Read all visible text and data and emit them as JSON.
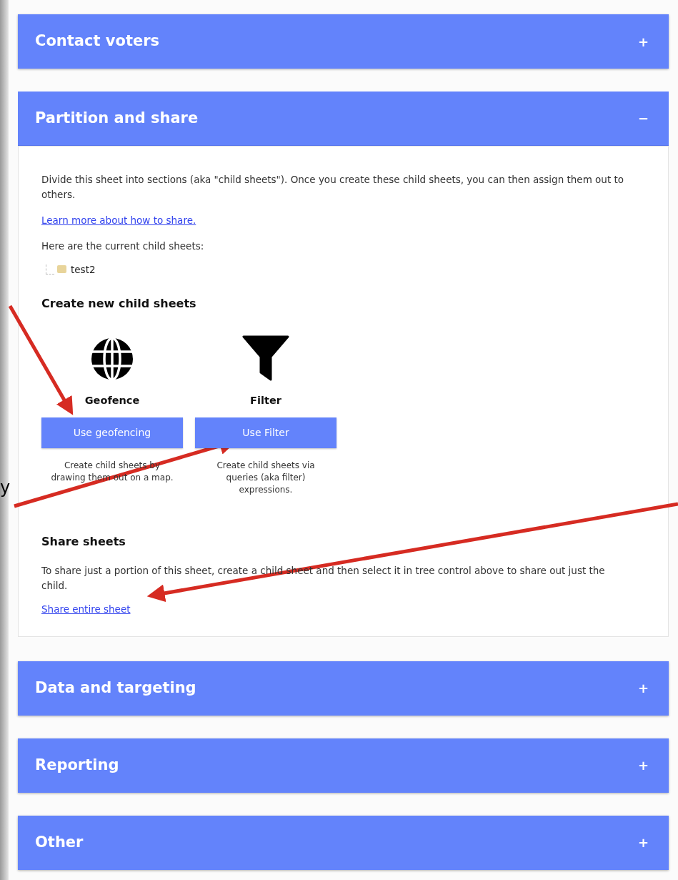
{
  "sections": [
    {
      "title": "Contact voters",
      "toggle": "+",
      "expanded": false
    },
    {
      "title": "Partition and share",
      "toggle": "−",
      "expanded": true,
      "body": {
        "description": "Divide this sheet into sections (aka \"child sheets\"). Once you create these child sheets, you can then assign them out to others.",
        "learn_link": "Learn more about how to share.",
        "tree_label": "Here are the current child sheets:",
        "tree": [
          {
            "label": "test2"
          }
        ],
        "create_heading": "Create new child sheets",
        "options": [
          {
            "title": "Geofence",
            "button": "Use geofencing",
            "description": "Create child sheets by drawing them out on a map."
          },
          {
            "title": "Filter",
            "button": "Use Filter",
            "description": "Create child sheets via queries (aka filter) expressions."
          }
        ],
        "share_heading": "Share sheets",
        "share_text": "To share just a portion of this sheet, create a child sheet and then select it in tree control above to share out just the child.",
        "share_link": "Share entire sheet"
      }
    },
    {
      "title": "Data and targeting",
      "toggle": "+",
      "expanded": false
    },
    {
      "title": "Reporting",
      "toggle": "+",
      "expanded": false
    },
    {
      "title": "Other",
      "toggle": "+",
      "expanded": false
    }
  ],
  "edge_fragment": "y"
}
